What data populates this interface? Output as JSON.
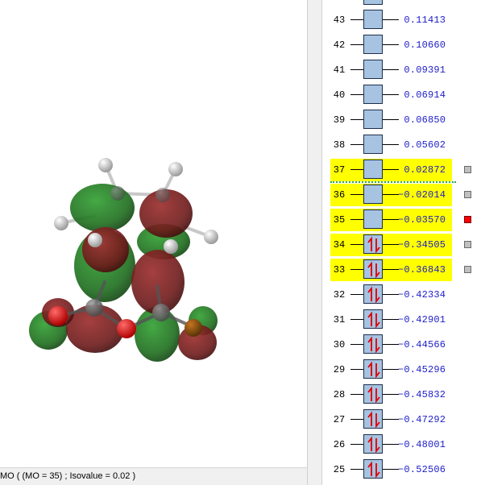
{
  "status_bar": {
    "text": "MO ( (MO = 35) ; Isovalue = 0.02 )"
  },
  "mo_diagram": {
    "occupied_marker": "↿⇂",
    "rows": [
      {
        "num": "43",
        "energy": " 0.11413",
        "occupied": false,
        "highlight": false,
        "swatch": null
      },
      {
        "num": "42",
        "energy": " 0.10660",
        "occupied": false,
        "highlight": false,
        "swatch": null
      },
      {
        "num": "41",
        "energy": " 0.09391",
        "occupied": false,
        "highlight": false,
        "swatch": null
      },
      {
        "num": "40",
        "energy": " 0.06914",
        "occupied": false,
        "highlight": false,
        "swatch": null
      },
      {
        "num": "39",
        "energy": " 0.06850",
        "occupied": false,
        "highlight": false,
        "swatch": null
      },
      {
        "num": "38",
        "energy": " 0.05602",
        "occupied": false,
        "highlight": false,
        "swatch": null
      },
      {
        "num": "37",
        "energy": " 0.02872",
        "occupied": false,
        "highlight": true,
        "swatch": "#c0c0c0"
      },
      {
        "num": "36",
        "energy": "−0.02014",
        "occupied": false,
        "highlight": true,
        "swatch": "#c0c0c0"
      },
      {
        "num": "35",
        "energy": "−0.03570",
        "occupied": false,
        "highlight": true,
        "swatch": "#ff0000"
      },
      {
        "num": "34",
        "energy": "−0.34505",
        "occupied": true,
        "highlight": true,
        "swatch": "#c0c0c0"
      },
      {
        "num": "33",
        "energy": "−0.36843",
        "occupied": true,
        "highlight": true,
        "swatch": "#c0c0c0"
      },
      {
        "num": "32",
        "energy": "−0.42334",
        "occupied": true,
        "highlight": false,
        "swatch": null
      },
      {
        "num": "31",
        "energy": "−0.42901",
        "occupied": true,
        "highlight": false,
        "swatch": null
      },
      {
        "num": "30",
        "energy": "−0.44566",
        "occupied": true,
        "highlight": false,
        "swatch": null
      },
      {
        "num": "29",
        "energy": "−0.45296",
        "occupied": true,
        "highlight": false,
        "swatch": null
      },
      {
        "num": "28",
        "energy": "−0.45832",
        "occupied": true,
        "highlight": false,
        "swatch": null
      },
      {
        "num": "27",
        "energy": "−0.47292",
        "occupied": true,
        "highlight": false,
        "swatch": null
      },
      {
        "num": "26",
        "energy": "−0.48001",
        "occupied": true,
        "highlight": false,
        "swatch": null
      },
      {
        "num": "25",
        "energy": "−0.52506",
        "occupied": true,
        "highlight": false,
        "swatch": null
      }
    ]
  },
  "colors": {
    "positive_lobe": "#1f7a1f",
    "negative_lobe": "#7a1717",
    "highlight": "#ffff00",
    "level_box": "#a7c3e2",
    "energy_text": "#1d1dc8",
    "selected_swatch": "#ff0000",
    "homo_lumo_gap_line": "#2aa84a"
  }
}
